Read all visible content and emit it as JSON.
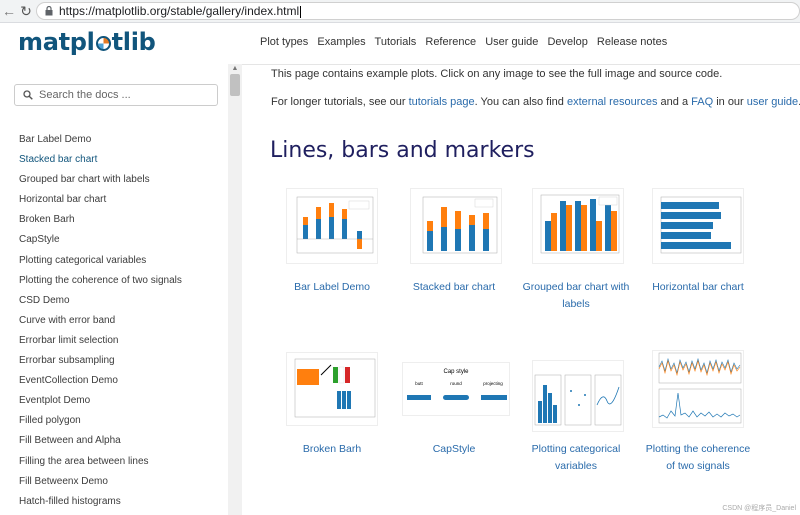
{
  "browser": {
    "url": "https://matplotlib.org/stable/gallery/index.html"
  },
  "header": {
    "logo_text_a": "matpl",
    "logo_text_b": "tlib",
    "nav": [
      "Plot types",
      "Examples",
      "Tutorials",
      "Reference",
      "User guide",
      "Develop",
      "Release notes"
    ]
  },
  "sidebar": {
    "search_placeholder": "Search the docs ...",
    "items": [
      "Bar Label Demo",
      "Stacked bar chart",
      "Grouped bar chart with labels",
      "Horizontal bar chart",
      "Broken Barh",
      "CapStyle",
      "Plotting categorical variables",
      "Plotting the coherence of two signals",
      "CSD Demo",
      "Curve with error band",
      "Errorbar limit selection",
      "Errorbar subsampling",
      "EventCollection Demo",
      "Eventplot Demo",
      "Filled polygon",
      "Fill Between and Alpha",
      "Filling the area between lines",
      "Fill Betweenx Demo",
      "Hatch-filled histograms"
    ],
    "active_index": 1
  },
  "main": {
    "intro1": "This page contains example plots. Click on any image to see the full image and source code.",
    "intro2_a": "For longer tutorials, see our ",
    "intro2_link1": "tutorials page",
    "intro2_b": ". You can also find ",
    "intro2_link2": "external resources",
    "intro2_c": " and a ",
    "intro2_link3": "FAQ",
    "intro2_d": " in our ",
    "intro2_link4": "user guide",
    "intro2_e": ".",
    "section_title": "Lines, bars and markers",
    "gallery": [
      {
        "line1": "Bar Label Demo",
        "line2": ""
      },
      {
        "line1": "Stacked bar chart",
        "line2": ""
      },
      {
        "line1": "Grouped bar chart with",
        "line2": "labels"
      },
      {
        "line1": "Horizontal bar chart",
        "line2": ""
      },
      {
        "line1": "Broken Barh",
        "line2": ""
      },
      {
        "line1": "CapStyle",
        "line2": ""
      },
      {
        "line1": "Plotting categorical",
        "line2": "variables"
      },
      {
        "line1": "Plotting the coherence",
        "line2": "of two signals"
      }
    ],
    "capstyle_thumb": {
      "title": "Cap style",
      "labels": [
        "butt",
        "round",
        "projecting"
      ]
    }
  },
  "watermark": "CSDN @程序员_Daniel",
  "colors": {
    "blue": "#1f77b4",
    "orange": "#ff7f0e",
    "green": "#2ca02c",
    "red": "#d62728",
    "link": "#2a6bab",
    "heading": "#1f1f5f",
    "logo": "#11557c"
  }
}
